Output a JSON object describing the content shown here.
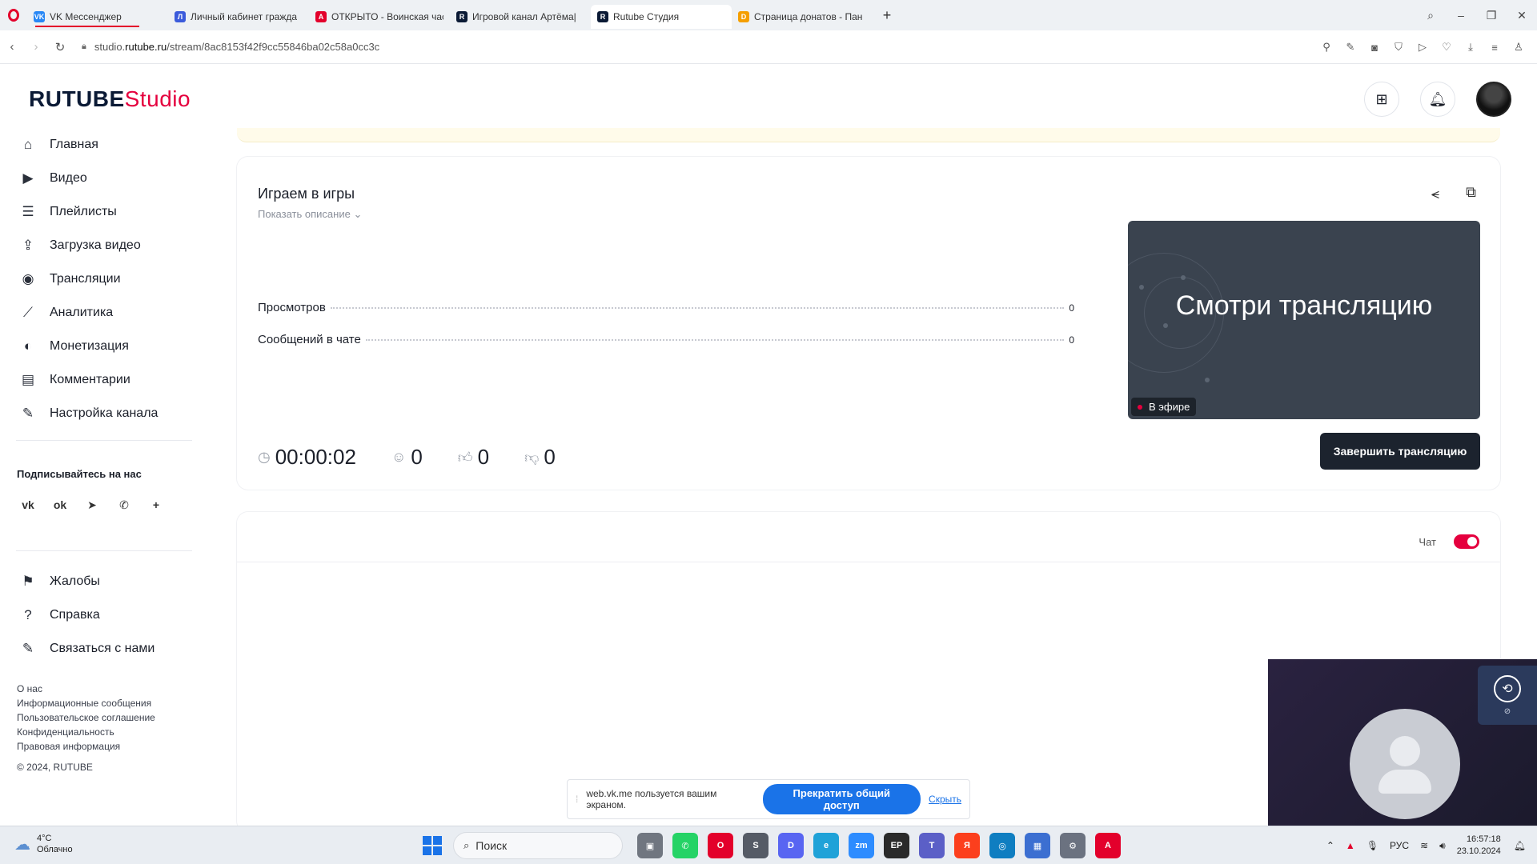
{
  "browser": {
    "tabs": [
      {
        "label": "VK Мессенджер",
        "color": "#2787f5",
        "glyph": "VK",
        "active": false
      },
      {
        "label": "Личный кабинет гражда",
        "color": "#3b5bdb",
        "glyph": "Л",
        "active": false
      },
      {
        "label": "ОТКРЫТО - Воинская час",
        "color": "#e3002b",
        "glyph": "А",
        "active": false
      },
      {
        "label": "Игровой канал Артёма|",
        "color": "#0b1a35",
        "glyph": "R",
        "active": false
      },
      {
        "label": "Rutube Студия",
        "color": "#0b1a35",
        "glyph": "R",
        "active": true
      },
      {
        "label": "Страница донатов - Пан",
        "color": "#f59f00",
        "glyph": "D",
        "active": false
      }
    ],
    "url_prefix": "studio.",
    "url_domain": "rutube.ru",
    "url_path": "/stream/8ac8153f42f9cc55846ba02c58a0cc3c"
  },
  "header": {
    "logo_main": "RUTUBE",
    "logo_sub": "Studio"
  },
  "sidebar": {
    "items": [
      {
        "label": "Главная",
        "icon": "home-icon",
        "glyph": "⌂"
      },
      {
        "label": "Видео",
        "icon": "video-icon",
        "glyph": "▶"
      },
      {
        "label": "Плейлисты",
        "icon": "playlist-icon",
        "glyph": "☰"
      },
      {
        "label": "Загрузка видео",
        "icon": "upload-icon",
        "glyph": "⇪"
      },
      {
        "label": "Трансляции",
        "icon": "broadcast-icon",
        "glyph": "◉"
      },
      {
        "label": "Аналитика",
        "icon": "analytics-icon",
        "glyph": "⟋"
      },
      {
        "label": "Монетизация",
        "icon": "monetization-icon",
        "glyph": "◐"
      },
      {
        "label": "Комментарии",
        "icon": "comments-icon",
        "glyph": "▤"
      },
      {
        "label": "Настройка канала",
        "icon": "channel-settings-icon",
        "glyph": "✎"
      }
    ],
    "follow_title": "Подписывайтесь на нас",
    "socials": [
      {
        "icon": "vk-icon",
        "glyph": "vk"
      },
      {
        "icon": "odnoklassniki-icon",
        "glyph": "ok"
      },
      {
        "icon": "telegram-icon",
        "glyph": "➤"
      },
      {
        "icon": "viber-icon",
        "glyph": "✆"
      },
      {
        "icon": "more-icon",
        "glyph": "+"
      }
    ],
    "secondary": [
      {
        "label": "Жалобы",
        "icon": "flag-icon",
        "glyph": "⚑"
      },
      {
        "label": "Справка",
        "icon": "help-icon",
        "glyph": "?"
      },
      {
        "label": "Связаться с нами",
        "icon": "contact-icon",
        "glyph": "✎"
      }
    ],
    "footer_links": [
      "О нас",
      "Информационные сообщения",
      "Пользовательское соглашение",
      "Конфиденциальность",
      "Правовая информация"
    ],
    "copyright": "© 2024, RUTUBE"
  },
  "stream": {
    "title": "Играем в игры",
    "show_description": "Показать описание",
    "stats": [
      {
        "label": "Просмотров",
        "value": "0"
      },
      {
        "label": "Сообщений в чате",
        "value": "0"
      }
    ],
    "preview_text": "Смотри трансляцию",
    "live_label": "В эфире",
    "end_button": "Завершить трансляцию",
    "duration": "00:00:02",
    "viewers": "0",
    "likes": "0",
    "dislikes": "0"
  },
  "chat": {
    "label": "Чат",
    "enabled": true
  },
  "screen_share": {
    "message": "web.vk.me пользуется вашим экраном.",
    "stop_button": "Прекратить общий доступ",
    "hide_link": "Скрыть"
  },
  "taskbar": {
    "temperature": "4°C",
    "weather": "Облачно",
    "search_placeholder": "Поиск",
    "language": "РУС",
    "time": "16:57:18",
    "date": "23.10.2024"
  },
  "colors": {
    "brand": "#e5003e",
    "dark": "#1c232e",
    "share_blue": "#1a73e8"
  }
}
